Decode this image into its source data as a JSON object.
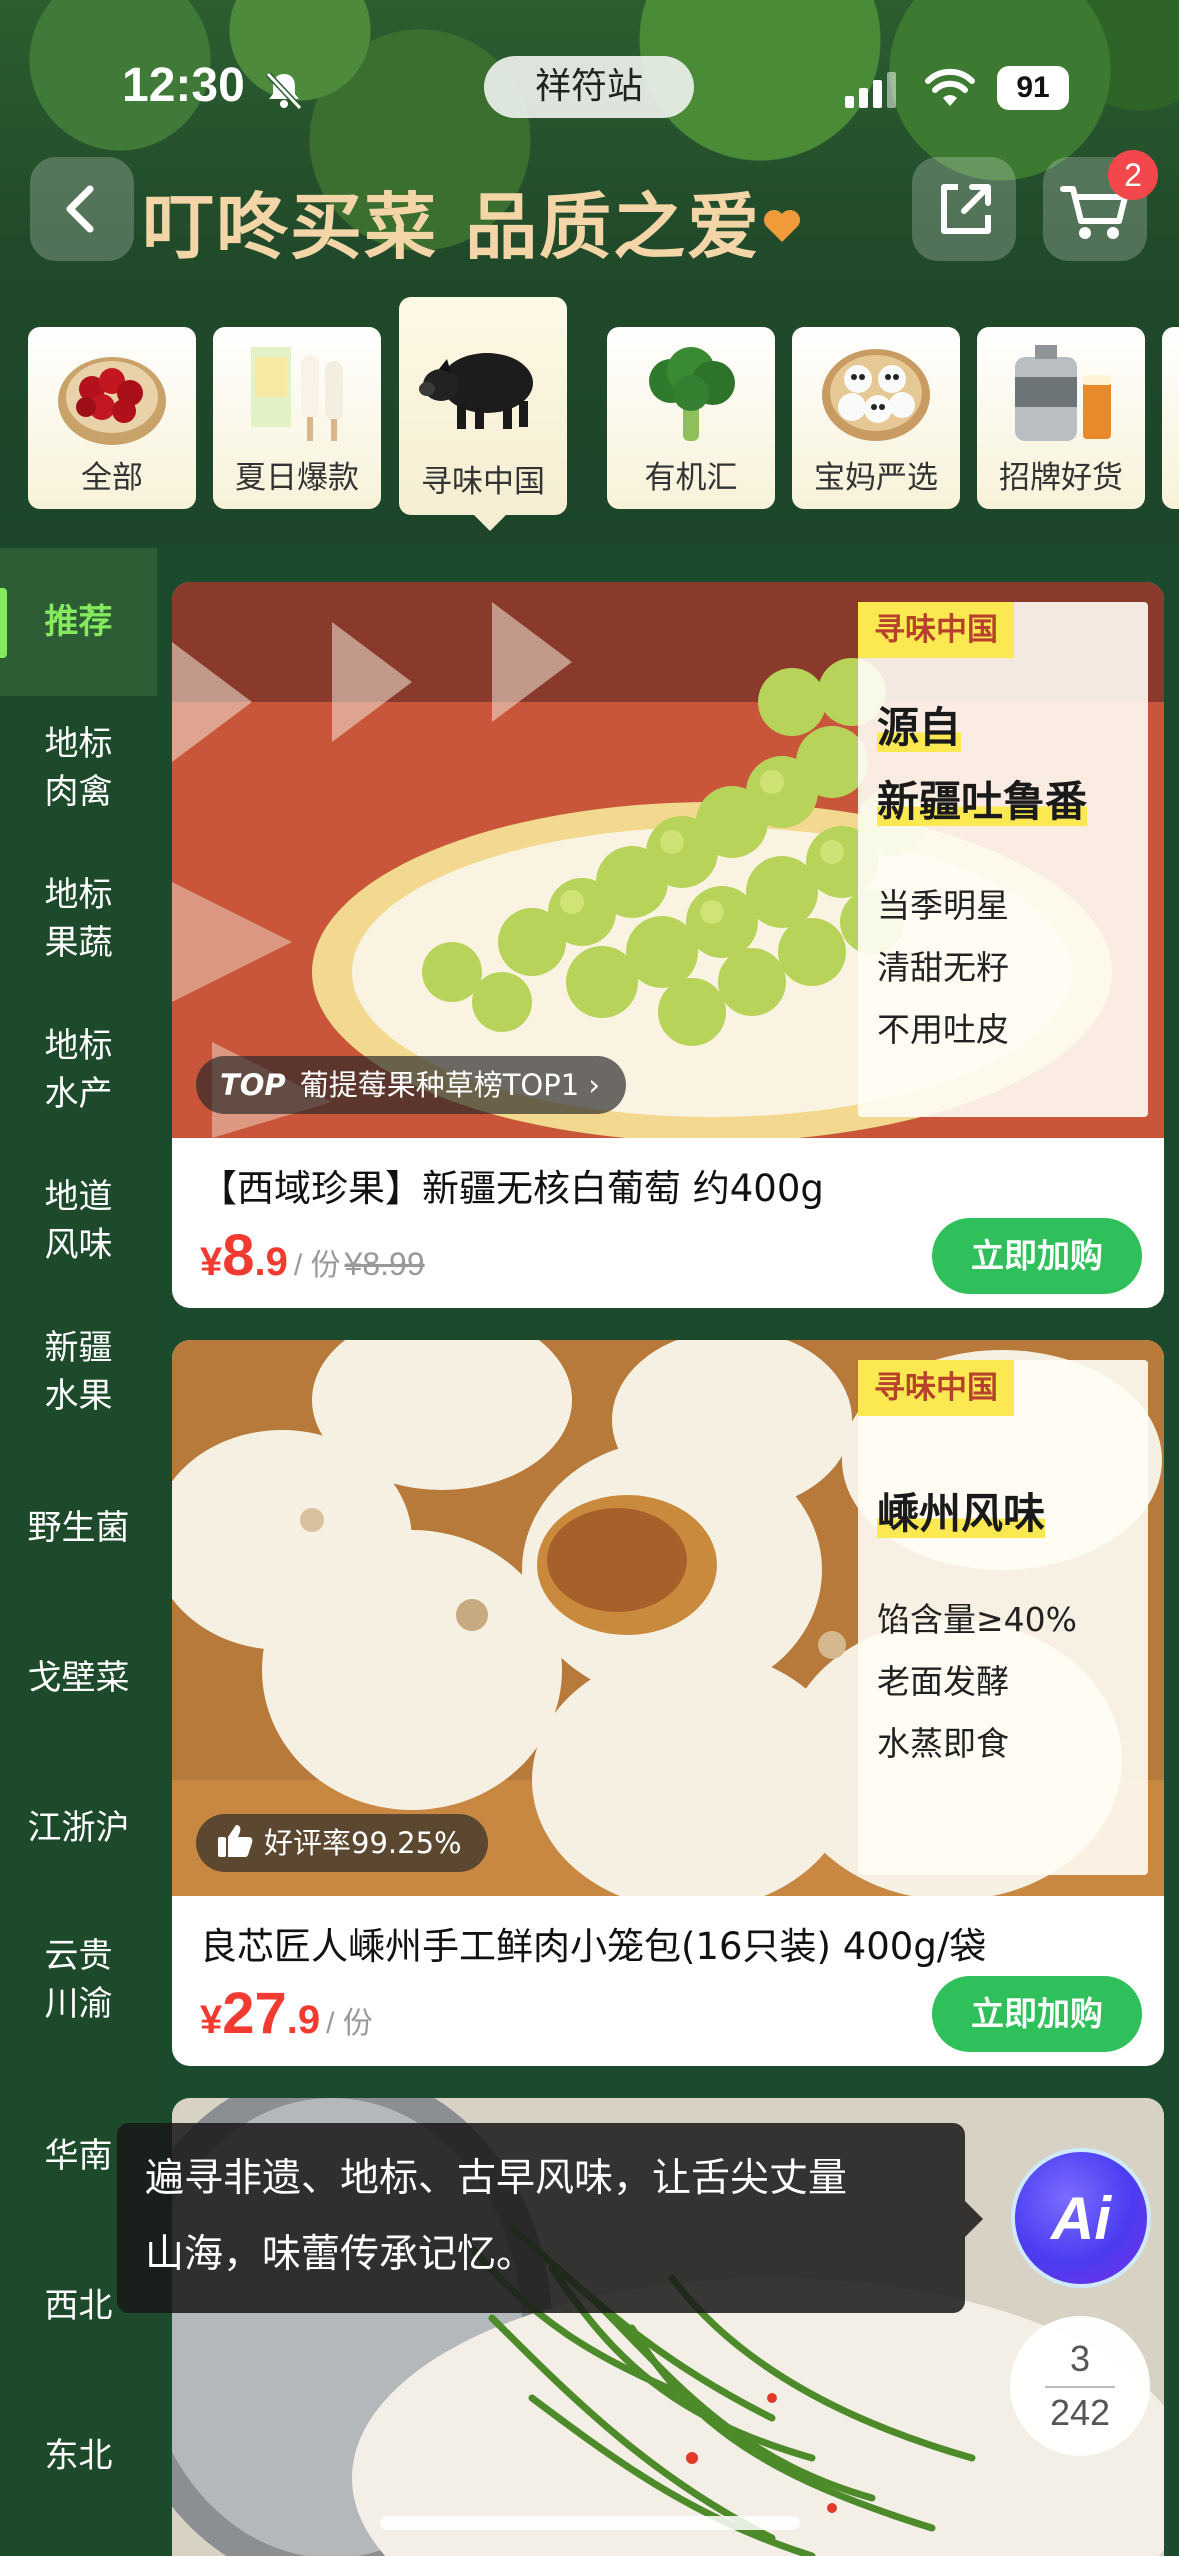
{
  "status_bar": {
    "time": "12:30",
    "location": "祥符站",
    "battery": "91"
  },
  "nav": {
    "title": "叮咚买菜 品质之爱",
    "cart_count": "2"
  },
  "categories": [
    {
      "label": "全部",
      "icon": "cherries-icon"
    },
    {
      "label": "夏日爆款",
      "icon": "popsicle-icon"
    },
    {
      "label": "寻味中国",
      "icon": "black-pig-icon"
    },
    {
      "label": "有机汇",
      "icon": "broccoli-icon"
    },
    {
      "label": "宝妈严选",
      "icon": "panda-buns-icon"
    },
    {
      "label": "招牌好货",
      "icon": "beer-keg-icon"
    }
  ],
  "active_category": "寻味中国",
  "sidebar": {
    "items": [
      {
        "label": "推荐"
      },
      {
        "label": "地标\n肉禽"
      },
      {
        "label": "地标\n果蔬"
      },
      {
        "label": "地标\n水产"
      },
      {
        "label": "地道\n风味"
      },
      {
        "label": "新疆\n水果"
      },
      {
        "label": "野生菌"
      },
      {
        "label": "戈壁菜"
      },
      {
        "label": "江浙沪"
      },
      {
        "label": "云贵\n川渝"
      },
      {
        "label": "华南"
      },
      {
        "label": "西北"
      },
      {
        "label": "东北"
      }
    ]
  },
  "products": [
    {
      "brand_tag": "寻味中国",
      "panel_title_1": "源自",
      "panel_title_2": "新疆吐鲁番",
      "panel_lines": [
        "当季明星",
        "清甜无籽",
        "不用吐皮"
      ],
      "rank_badge": "TOP",
      "rank_text": "葡提莓果种草榜TOP1 ›",
      "title": "【西域珍果】新疆无核白葡萄 约400g",
      "price_symbol": "¥",
      "price_int": "8",
      "price_dec": ".9",
      "unit": "/ 份",
      "original_price": "¥8.99",
      "button": "立即加购",
      "image": "green-grapes-photo"
    },
    {
      "brand_tag": "寻味中国",
      "panel_title_1": "嵊州风味",
      "panel_lines": [
        "馅含量≥40%",
        "老面发酵",
        "水蒸即食"
      ],
      "rating_text": "好评率99.25%",
      "title": "良芯匠人嵊州手工鲜肉小笼包(16只装) 400g/袋",
      "price_symbol": "¥",
      "price_int": "27",
      "price_dec": ".9",
      "unit": "/ 份",
      "button": "立即加购",
      "image": "steamed-buns-photo"
    },
    {
      "image": "stir-fried-greens-photo"
    }
  ],
  "tooltip": {
    "line1": "遍寻非遗、地标、古早风味，让舌尖丈量",
    "line2": "山海，味蕾传承记忆。"
  },
  "ai_button": {
    "label": "Ai"
  },
  "pager": {
    "current": "3",
    "total": "242"
  },
  "colors": {
    "accent_green": "#2fc05b",
    "price_red": "#f23b30",
    "tag_yellow": "#fce952",
    "sidebar_active": "#86ea5e",
    "background": "#1b4a2c"
  }
}
